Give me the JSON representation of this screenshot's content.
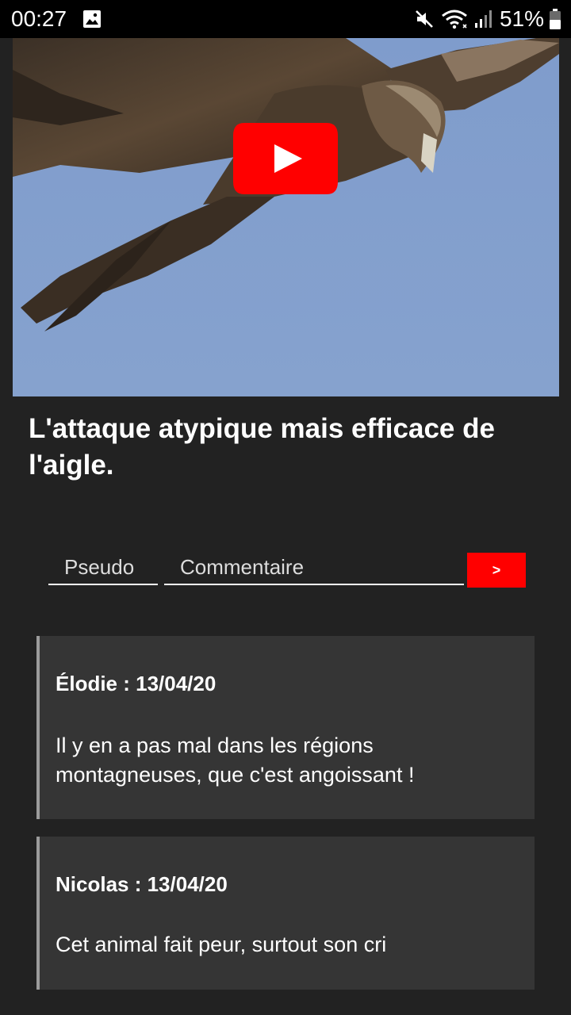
{
  "status_bar": {
    "time": "00:27",
    "battery": "51%",
    "icons": [
      "gallery-icon",
      "mute-icon",
      "wifi-icon",
      "signal-icon",
      "battery-icon"
    ]
  },
  "video": {
    "description_icon": "youtube-play-icon",
    "colors": {
      "play_button": "#ff0000",
      "sky": "#84a0cc"
    }
  },
  "article": {
    "title": "L'attaque atypique mais efficace de l'aigle."
  },
  "comment_form": {
    "pseudo_placeholder": "Pseudo",
    "comment_placeholder": "Commentaire",
    "submit_label": ">"
  },
  "comments": [
    {
      "author_line": "Élodie : 13/04/20",
      "text": "Il y en a pas mal dans les régions montagneuses, que c'est angoissant !"
    },
    {
      "author_line": "Nicolas : 13/04/20",
      "text": "Cet animal fait peur, surtout son cri"
    }
  ],
  "colors": {
    "background": "#222222",
    "card": "#353535",
    "card_border": "#9b9b9b",
    "accent": "#ff0000"
  }
}
